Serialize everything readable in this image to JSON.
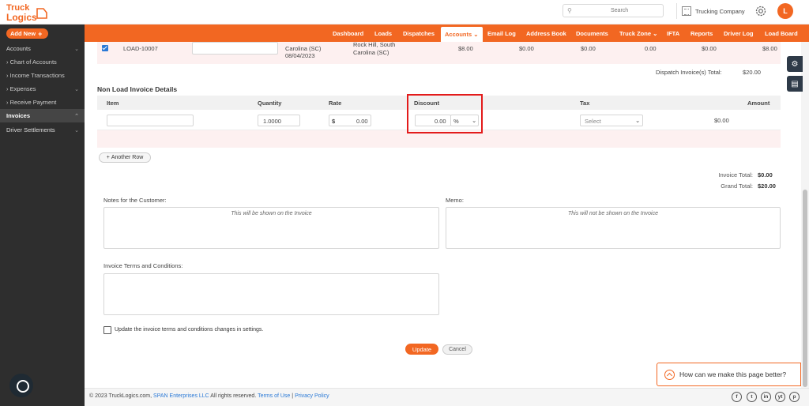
{
  "brand": {
    "name": "TruckLogics",
    "accent": "#f26722"
  },
  "header": {
    "search_placeholder": "Search",
    "company": "Trucking Company",
    "avatar_initial": "L"
  },
  "sidebar": {
    "add_new": "Add New",
    "items": [
      {
        "label": "Accounts",
        "type": "group"
      },
      {
        "label": "Chart of Accounts",
        "type": "sub"
      },
      {
        "label": "Income Transactions",
        "type": "sub"
      },
      {
        "label": "Expenses",
        "type": "sub"
      },
      {
        "label": "Receive Payment",
        "type": "sub"
      },
      {
        "label": "Invoices",
        "type": "active"
      },
      {
        "label": "Driver Settlements",
        "type": "group"
      }
    ]
  },
  "nav": {
    "items": [
      "Dashboard",
      "Loads",
      "Dispatches",
      "Accounts",
      "Email Log",
      "Address Book",
      "Documents",
      "Truck Zone",
      "IFTA",
      "Reports",
      "Driver Log",
      "Load Board"
    ],
    "active": "Accounts"
  },
  "load_row": {
    "id": "LOAD-10007",
    "origin_line1": "Carolina (SC)",
    "origin_line2": "08/04/2023",
    "dest_line1": "Rock Hill, South",
    "dest_line2": "Carolina (SC)",
    "amount1": "$8.00",
    "amount2": "$0.00",
    "amount3": "$0.00",
    "amount4": "0.00",
    "amount5": "$0.00",
    "amount6": "$8.00"
  },
  "dispatch": {
    "label": "Dispatch Invoice(s) Total:",
    "value": "$20.00"
  },
  "non_load": {
    "title": "Non Load Invoice Details",
    "headers": {
      "item": "Item",
      "quantity": "Quantity",
      "rate": "Rate",
      "discount": "Discount",
      "tax": "Tax",
      "amount": "Amount"
    },
    "row": {
      "quantity": "1.0000",
      "rate_symbol": "$",
      "rate": "0.00",
      "discount": "0.00",
      "discount_unit": "%",
      "tax_placeholder": "Select",
      "amount": "$0.00"
    },
    "another_row": "Another Row"
  },
  "totals": {
    "invoice_label": "Invoice Total:",
    "invoice_value": "$0.00",
    "grand_label": "Grand Total:",
    "grand_value": "$20.00"
  },
  "notes": {
    "label": "Notes for the Customer:",
    "placeholder": "This will be shown on the Invoice"
  },
  "memo": {
    "label": "Memo:",
    "placeholder": "This will not be shown on the Invoice"
  },
  "terms": {
    "label": "Invoice Terms and Conditions:",
    "update_settings": "Update the invoice terms and conditions changes in settings."
  },
  "actions": {
    "update": "Update",
    "cancel": "Cancel"
  },
  "feedback": "How can we make this page better?",
  "footer": {
    "copyright": "© 2023 TruckLogics.com,",
    "company_link": "SPAN Enterprises LLC",
    "rights": "All rights reserved.",
    "terms": "Terms of Use",
    "sep": "|",
    "privacy": "Privacy Policy"
  },
  "social": [
    "f",
    "t",
    "in",
    "yt",
    "p"
  ]
}
